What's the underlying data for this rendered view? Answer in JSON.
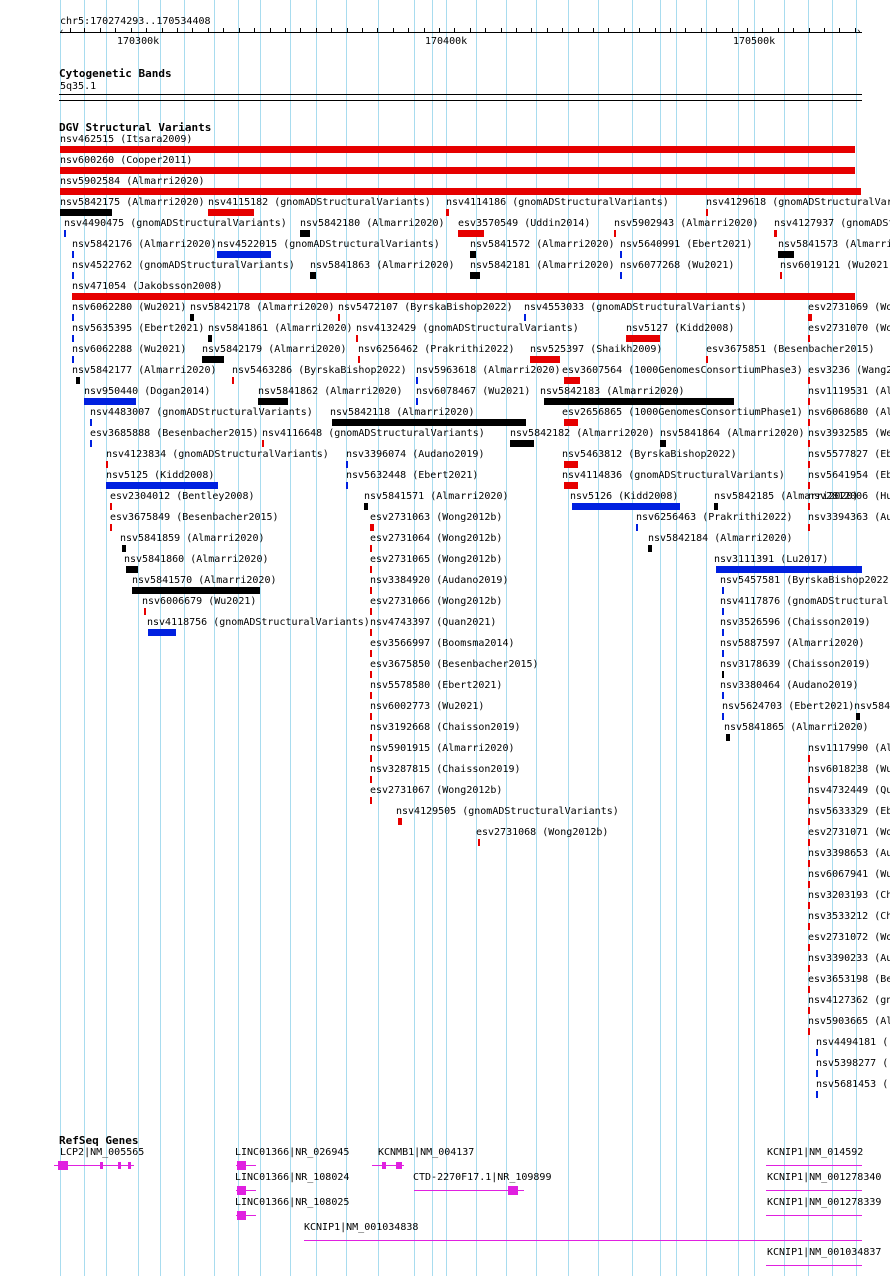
{
  "region": {
    "label": "chr5:170274293..170534408",
    "ticks": [
      "170300k",
      "170400k",
      "170500k"
    ]
  },
  "cyto": {
    "title": "Cytogenetic Bands",
    "band": "5q35.1"
  },
  "dgv": {
    "title": "DGV Structural Variants",
    "labels": [
      "nsv462515 (Itsara2009)",
      "nsv600260 (Cooper2011)",
      "nsv5902584 (Almarri2020)",
      "nsv5842175 (Almarri2020)",
      "nsv4115182 (gnomADStructuralVariants)",
      "nsv4114186 (gnomADStructuralVariants)",
      "nsv4129618 (gnomADStructuralVar",
      "nsv4490475 (gnomADStructuralVariants)",
      "nsv5842180 (Almarri2020)",
      "esv3570549 (Uddin2014)",
      "nsv5902943 (Almarri2020)",
      "nsv4127937 (gnomADSt",
      "nsv5842176 (Almarri2020)",
      "nsv4522015 (gnomADStructuralVariants)",
      "nsv5841572 (Almarri2020)",
      "nsv5640991 (Ebert2021)",
      "nsv5841573 (Almarri",
      "nsv4522762 (gnomADStructuralVariants)",
      "nsv5841863 (Almarri2020)",
      "nsv5842181 (Almarri2020)",
      "nsv6077268 (Wu2021)",
      "nsv6019121 (Wu2021",
      "nsv471054 (Jakobsson2008)",
      "nsv6062280 (Wu2021)",
      "nsv5842178 (Almarri2020)",
      "nsv5472107 (ByrskaBishop2022)",
      "nsv4553033 (gnomADStructuralVariants)",
      "esv2731069 (Wo",
      "nsv5635395 (Ebert2021)",
      "nsv5841861 (Almarri2020)",
      "nsv4132429 (gnomADStructuralVariants)",
      "nsv5127 (Kidd2008)",
      "esv2731070 (Wo",
      "nsv6062288 (Wu2021)",
      "nsv5842179 (Almarri2020)",
      "nsv6256462 (Prakrithi2022)",
      "nsv525397 (Shaikh2009)",
      "esv3675851 (Besenbacher2015)",
      "nsv5842177 (Almarri2020)",
      "nsv5463286 (ByrskaBishop2022)",
      "nsv5963618 (Almarri2020)",
      "esv3607564 (1000GenomesConsortiumPhase3)",
      "esv3236 (Wang2",
      "nsv950440 (Dogan2014)",
      "nsv5841862 (Almarri2020)",
      "nsv6078467 (Wu2021)",
      "nsv5842183 (Almarri2020)",
      "nsv1119531 (Al",
      "nsv4483007 (gnomADStructuralVariants)",
      "nsv5842118 (Almarri2020)",
      "esv2656865 (1000GenomesConsortiumPhase1)",
      "nsv6068680 (Al",
      "esv3685888 (Besenbacher2015)",
      "nsv4116648 (gnomADStructuralVariants)",
      "nsv5842182 (Almarri2020)",
      "nsv5841864 (Almarri2020)",
      "nsv3932585 (We",
      "nsv4123834 (gnomADStructuralVariants)",
      "nsv3396074 (Audano2019)",
      "nsv5463812 (ByrskaBishop2022)",
      "nsv5577827 (Eb",
      "nsv5125 (Kidd2008)",
      "nsv5632448 (Ebert2021)",
      "nsv4114836 (gnomADStructuralVariants)",
      "nsv5641954 (Eb",
      "esv2304012 (Bentley2008)",
      "nsv5841571 (Almarri2020)",
      "nsv5126 (Kidd2008)",
      "nsv5842185 (Almarri2020)",
      "nsv2812006 (Hu",
      "esv3675849 (Besenbacher2015)",
      "esv2731063 (Wong2012b)",
      "nsv6256463 (Prakrithi2022)",
      "nsv3394363 (Au",
      "nsv5841859 (Almarri2020)",
      "esv2731064 (Wong2012b)",
      "nsv5842184 (Almarri2020)",
      "nsv5841860 (Almarri2020)",
      "esv2731065 (Wong2012b)",
      "nsv3111391 (Lu2017)",
      "nsv5841570 (Almarri2020)",
      "nsv3384920 (Audano2019)",
      "nsv5457581 (ByrskaBishop2022",
      "nsv6006679 (Wu2021)",
      "esv2731066 (Wong2012b)",
      "nsv4117876 (gnomADStructural",
      "nsv4118756 (gnomADStructuralVariants)",
      "nsv4743397 (Quan2021)",
      "nsv3526596 (Chaisson2019)",
      "esv3566997 (Boomsma2014)",
      "nsv5887597 (Almarri2020)",
      "esv3675850 (Besenbacher2015)",
      "nsv3178639 (Chaisson2019)",
      "nsv5578580 (Ebert2021)",
      "nsv3380464 (Audano2019)",
      "nsv6002773 (Wu2021)",
      "nsv5624703 (Ebert2021)",
      "nsv584",
      "nsv3192668 (Chaisson2019)",
      "nsv5841865 (Almarri2020)",
      "nsv5901915 (Almarri2020)",
      "nsv1117990 (Al",
      "nsv3287815 (Chaisson2019)",
      "nsv6018238 (Wu",
      "esv2731067 (Wong2012b)",
      "nsv4732449 (Qu",
      "nsv4129505 (gnomADStructuralVariants)",
      "nsv5633329 (Eb",
      "esv2731068 (Wong2012b)",
      "esv2731071 (Wo",
      "nsv3398653 (Au",
      "nsv6067941 (Wu",
      "nsv3203193 (Ch",
      "nsv3533212 (Ch",
      "esv2731072 (Wo",
      "nsv3390233 (Au",
      "esv3653198 (Be",
      "nsv4127362 (gn",
      "nsv5903665 (Al",
      "nsv4494181 (",
      "nsv5398277 (",
      "nsv5681453 ("
    ]
  },
  "refseq": {
    "title": "RefSeq Genes",
    "labels": [
      "LCP2|NM_005565",
      "LINC01366|NR_026945",
      "KCNMB1|NM_004137",
      "KCNIP1|NM_014592",
      "LINC01366|NR_108024",
      "CTD-2270F17.1|NR_109899",
      "KCNIP1|NM_001278340",
      "LINC01366|NR_108025",
      "KCNIP1|NM_001278339",
      "KCNIP1|NM_001034838",
      "KCNIP1|NM_001034837"
    ]
  },
  "colors": {
    "loss": "#e60000",
    "gain": "#0020e0",
    "complex": "#000000",
    "gene": "#e020e0",
    "grid": "#a8dcef"
  }
}
